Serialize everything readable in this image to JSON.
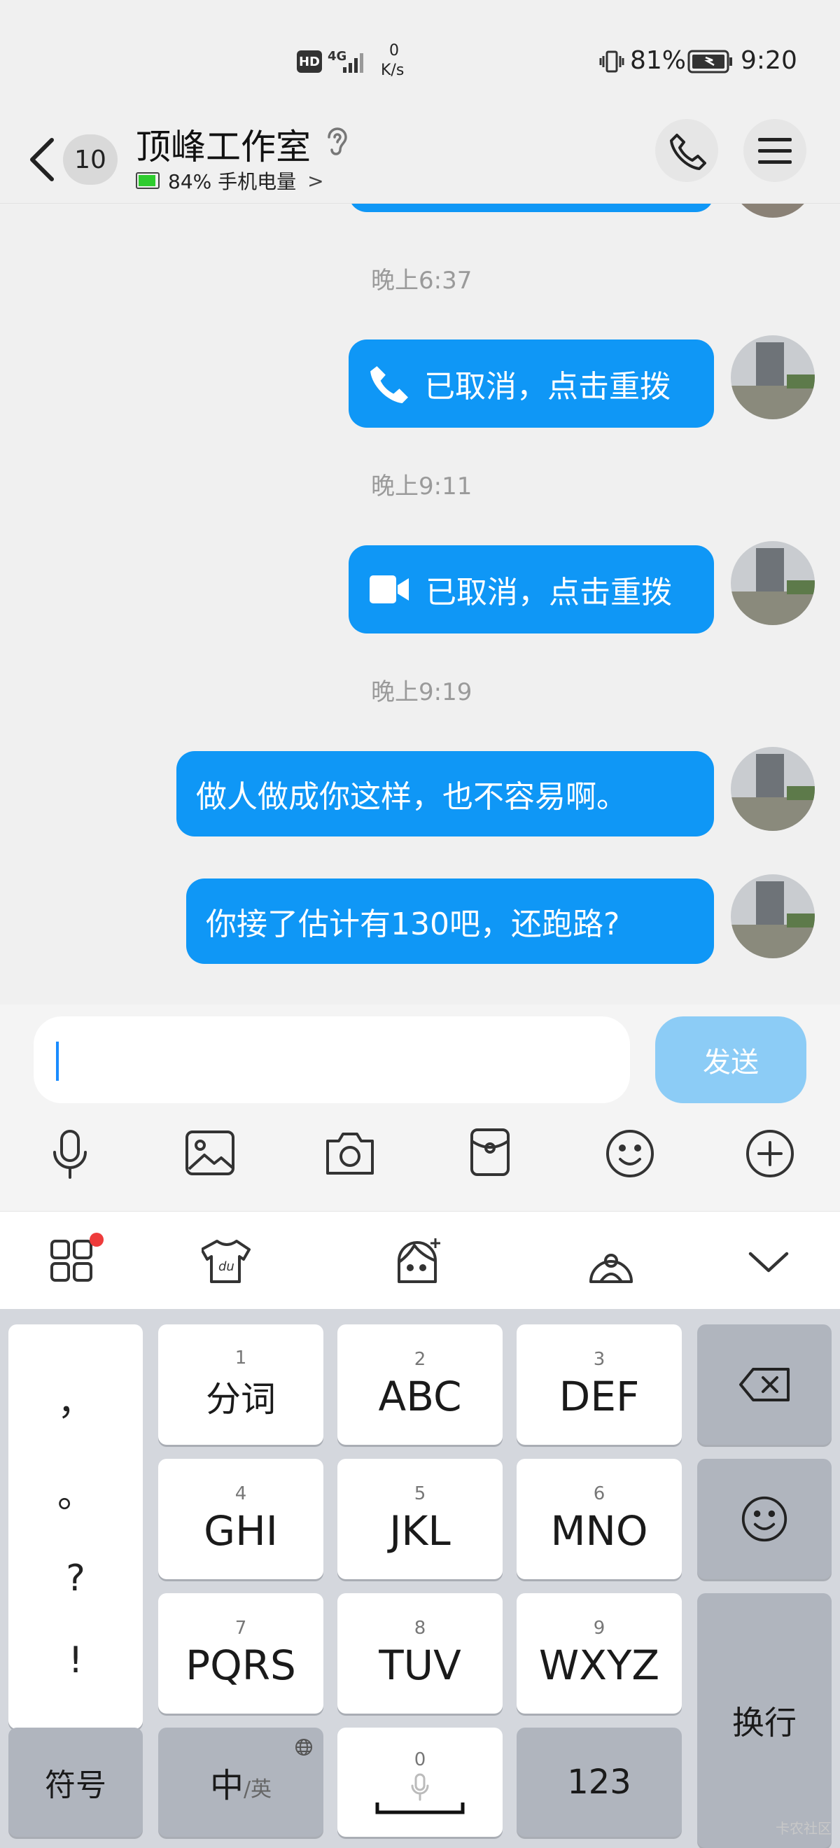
{
  "status_bar": {
    "hd": "HD",
    "network": "4G",
    "speed_value": "0",
    "speed_unit": "K/s",
    "battery": "81%",
    "time": "9:20"
  },
  "header": {
    "unread_count": "10",
    "title": "顶峰工作室",
    "subtitle": "84% 手机电量",
    "subtitle_chevron": ">"
  },
  "messages": [
    {
      "type": "time",
      "text": "晚上6:37"
    },
    {
      "type": "call",
      "icon": "phone-icon",
      "text": "已取消，点击重拨"
    },
    {
      "type": "time",
      "text": "晚上9:11"
    },
    {
      "type": "call",
      "icon": "video-icon",
      "text": "已取消，点击重拨"
    },
    {
      "type": "time",
      "text": "晚上9:19"
    },
    {
      "type": "text",
      "text": "做人做成你这样，也不容易啊。"
    },
    {
      "type": "text",
      "text": "你接了估计有130吧，还跑路?"
    }
  ],
  "input": {
    "value": "",
    "send_label": "发送"
  },
  "toolbar_icons": [
    "microphone-icon",
    "image-icon",
    "camera-icon",
    "red-packet-icon",
    "emoji-icon",
    "plus-icon"
  ],
  "keyboard_toolbar": [
    "apps-icon",
    "skin-icon",
    "sticker-icon",
    "theme-icon",
    "collapse-icon"
  ],
  "keyboard": {
    "punct": [
      "，",
      "。",
      "?",
      "!"
    ],
    "keys": [
      {
        "num": "1",
        "label": "分词"
      },
      {
        "num": "2",
        "label": "ABC"
      },
      {
        "num": "3",
        "label": "DEF"
      },
      {
        "num": "4",
        "label": "GHI"
      },
      {
        "num": "5",
        "label": "JKL"
      },
      {
        "num": "6",
        "label": "MNO"
      },
      {
        "num": "7",
        "label": "PQRS"
      },
      {
        "num": "8",
        "label": "TUV"
      },
      {
        "num": "9",
        "label": "WXYZ"
      }
    ],
    "symbols": "符号",
    "lang_main": "中",
    "lang_sub": "/英",
    "space_num": "0",
    "num_key": "123",
    "enter": "换行"
  },
  "watermark": "卡农社区"
}
